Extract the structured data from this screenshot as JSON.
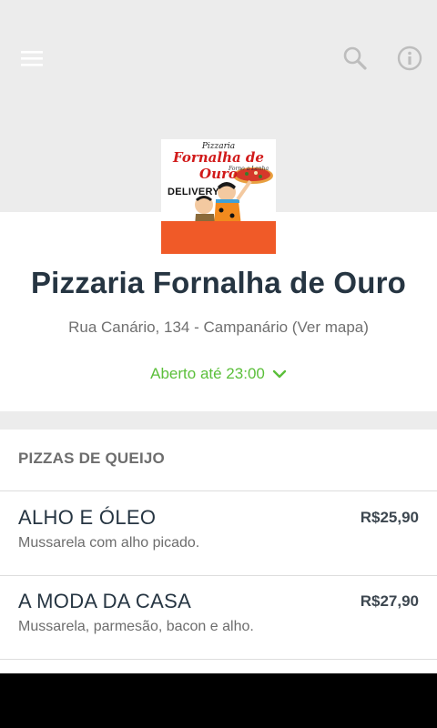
{
  "header": {
    "menu_icon": "hamburger-menu-icon",
    "search_icon": "search-icon",
    "info_icon": "info-icon"
  },
  "logo": {
    "top_text": "Pizzaria",
    "title": "Fornalha de Ouro",
    "subtitle": "Forno a Lenha",
    "delivery": "DELIVERY",
    "colors": {
      "bottom": "#f05a28",
      "title": "#d11a1a"
    }
  },
  "store": {
    "name": "Pizzaria Fornalha de Ouro",
    "address": "Rua Canário, 134 - Campanário (Ver mapa)",
    "hours": "Aberto até 23:00",
    "hours_color": "#5bbf3a"
  },
  "menu": {
    "section_title": "PIZZAS DE QUEIJO",
    "items": [
      {
        "name": "ALHO E ÓLEO",
        "description": "Mussarela com alho picado.",
        "price": "R$25,90"
      },
      {
        "name": "A MODA DA CASA",
        "description": "Mussarela, parmesão, bacon e alho.",
        "price": "R$27,90"
      }
    ]
  }
}
